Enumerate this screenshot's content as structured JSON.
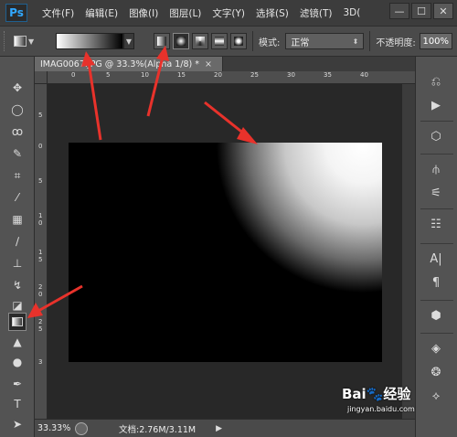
{
  "app": {
    "logo": "Ps"
  },
  "menu": [
    "文件(F)",
    "编辑(E)",
    "图像(I)",
    "图层(L)",
    "文字(Y)",
    "选择(S)",
    "滤镜(T)",
    "3D("
  ],
  "window_controls": {
    "minimize": "—",
    "restore": "☐",
    "close": "✕"
  },
  "options": {
    "gradient_types": [
      "linear",
      "radial",
      "angle",
      "reflected",
      "diamond"
    ],
    "active_gradient_type": "radial",
    "mode_label": "模式:",
    "mode_value": "正常",
    "opacity_label": "不透明度:",
    "opacity_value": "100%"
  },
  "document": {
    "tab_title": "IMAG0067.JPG @ 33.3%(Alpha 1/8) *",
    "tab_close": "×",
    "ruler_top": [
      "0",
      "5",
      "10",
      "15",
      "20",
      "25",
      "30",
      "35",
      "40"
    ],
    "ruler_left": [
      "5",
      "0",
      "5",
      "1",
      "0",
      "1",
      "5",
      "2",
      "0",
      "2",
      "5",
      "3"
    ]
  },
  "status": {
    "zoom": "33.33%",
    "doc_info": "文档:2.76M/3.11M",
    "arrow": "▶"
  },
  "tools": [
    "move-tool",
    "marquee-tool",
    "lasso-tool",
    "quick-select-tool",
    "crop-tool",
    "eyedropper-tool",
    "healing-brush-tool",
    "brush-tool",
    "clone-stamp-tool",
    "history-brush-tool",
    "eraser-tool",
    "gradient-tool",
    "blur-tool",
    "dodge-tool",
    "pen-tool",
    "type-tool",
    "path-select-tool"
  ],
  "colors": {
    "annotation_red": "#e8322b",
    "canvas_black": "#000000",
    "highlight_white": "#ffffff"
  },
  "watermark": {
    "logo": "Bai🐾经验",
    "url": "jingyan.baidu.com"
  }
}
